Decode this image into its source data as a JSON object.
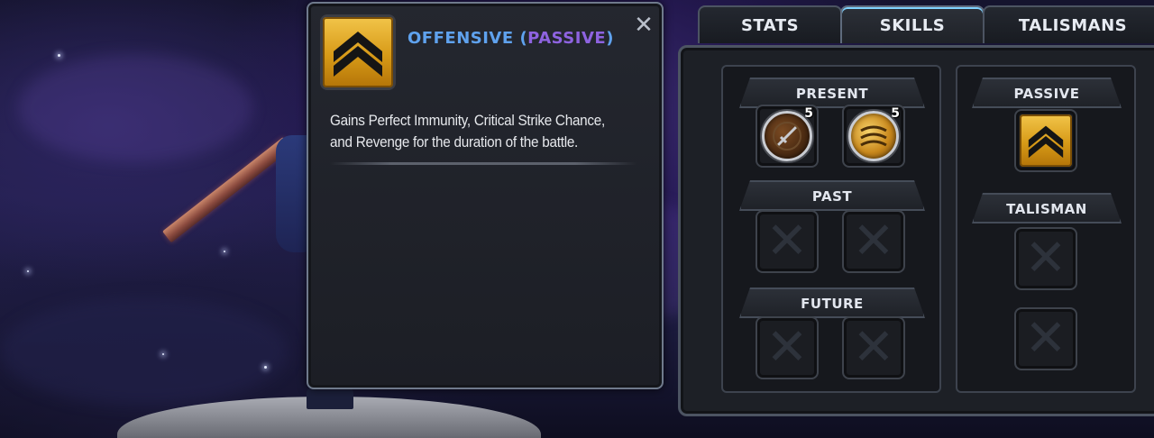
{
  "info_panel": {
    "title_main": "OFFENSIVE",
    "title_open": "(",
    "title_passive": "PASSIVE",
    "title_close": ")",
    "close_glyph": "✕",
    "icon": "chevron-rank-icon",
    "description_line1": "Gains Perfect Immunity, Critical Strike Chance,",
    "description_line2": "and Revenge for the duration of the battle."
  },
  "tabs": [
    {
      "label": "STATS",
      "active": false
    },
    {
      "label": "SKILLS",
      "active": true
    },
    {
      "label": "TALISMANS",
      "active": false
    }
  ],
  "skills": {
    "present": {
      "label": "PRESENT",
      "items": [
        {
          "icon": "sword-rune-icon",
          "rank": "5"
        },
        {
          "icon": "golden-swirl-icon",
          "rank": "5"
        }
      ]
    },
    "past": {
      "label": "PAST",
      "slots": [
        "empty",
        "empty"
      ]
    },
    "future": {
      "label": "FUTURE",
      "slots": [
        "empty",
        "empty"
      ]
    },
    "passive": {
      "label": "PASSIVE",
      "icon": "chevron-rank-icon"
    },
    "talisman": {
      "label": "TALISMAN",
      "slots": [
        "empty",
        "empty"
      ]
    }
  },
  "colors": {
    "title_blue": "#5fa2ee",
    "passive_purple": "#8e63e0",
    "gold": "#f2c54a",
    "active_tab_accent": "#7fd2ff"
  }
}
